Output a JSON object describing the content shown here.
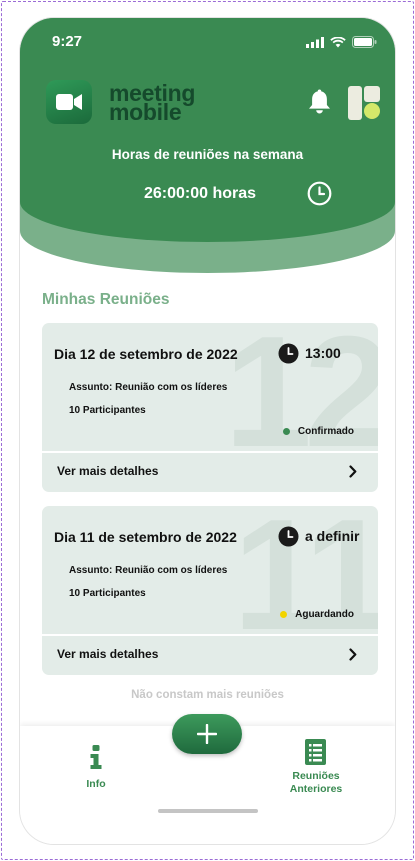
{
  "status_bar": {
    "time": "9:27"
  },
  "brand": {
    "line1": "meeting",
    "line2": "mobile"
  },
  "summary": {
    "label": "Horas de reuniões na semana",
    "value": "26:00:00 horas"
  },
  "section_title": "Minhas Reuniões",
  "meetings": [
    {
      "big_number": "12",
      "date": "Dia 12 de setembro de 2022",
      "time": "13:00",
      "subject": "Assunto: Reunião com os líderes",
      "participants": "10 Participantes",
      "status": "Confirmado",
      "status_color": "#3a8a52",
      "details_label": "Ver mais detalhes"
    },
    {
      "big_number": "11",
      "date": "Dia 11 de setembro de 2022",
      "time": "a definir",
      "subject": "Assunto: Reunião com os líderes",
      "participants": "10 Participantes",
      "status": "Aguardando",
      "status_color": "#f2d400",
      "details_label": "Ver mais detalhes"
    }
  ],
  "no_more_text": "Não constam mais reuniões",
  "nav": {
    "info_label": "Info",
    "previous_label_1": "Reuniões",
    "previous_label_2": "Anteriores"
  },
  "colors": {
    "primary": "#3a8a52",
    "secondary": "#7ab08a",
    "card_bg": "#e3ece8"
  },
  "icons": [
    "camera-icon",
    "bell-icon",
    "clock-icon",
    "chevron-right-icon",
    "plus-icon",
    "info-icon",
    "list-icon"
  ]
}
